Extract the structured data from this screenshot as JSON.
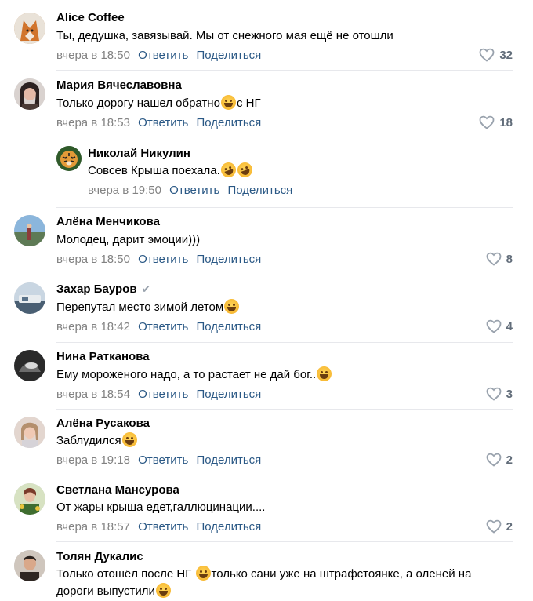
{
  "actions": {
    "reply": "Ответить",
    "share": "Поделиться"
  },
  "comments": [
    {
      "author": "Alice Coffee",
      "text": "Ты, дедушка, завязывай. Мы от снежного мая ещё не отошли",
      "date": "вчера в 18:50",
      "likes": "32",
      "avatar_color": "#c58a52"
    },
    {
      "author": "Мария Вячеславовна",
      "text": "Только дорогу нашел обратно",
      "text2": "с НГ",
      "date": "вчера в 18:53",
      "likes": "18",
      "avatar_color": "#5b4a44"
    },
    {
      "author": "Николай Никулин",
      "text": "Совсев Крыша поехала.",
      "date": "вчера в 19:50",
      "likes": "",
      "avatar_color": "#8a7b2e"
    },
    {
      "author": "Алёна Менчикова",
      "text": "Молодец, дарит эмоции)))",
      "date": "вчера в 18:50",
      "likes": "8",
      "avatar_color": "#6d97c3"
    },
    {
      "author": "Захар Бауров",
      "text": "Перепутал место зимой летом",
      "date": "вчера в 18:42",
      "likes": "4",
      "avatar_color": "#7f9fb8"
    },
    {
      "author": "Нина Ратканова",
      "text": "Ему мороженого надо, а то растает не дай бог..",
      "date": "вчера в 18:54",
      "likes": "3",
      "avatar_color": "#3b3b3b"
    },
    {
      "author": "Алёна Русакова",
      "text": "Заблудился",
      "date": "вчера в 19:18",
      "likes": "2",
      "avatar_color": "#c9a89a"
    },
    {
      "author": "Светлана Мансурова",
      "text": "От жары крыша едет,галлюцинации....",
      "date": "вчера в 18:57",
      "likes": "2",
      "avatar_color": "#5f6e3c"
    },
    {
      "author": "Толян Дукалис",
      "text": "Только отошёл после НГ",
      "text2": "только сани уже на штрафстоянке, а оленей на",
      "text3": "дороги выпустили",
      "date": "",
      "likes": "",
      "avatar_color": "#3e3530"
    }
  ]
}
